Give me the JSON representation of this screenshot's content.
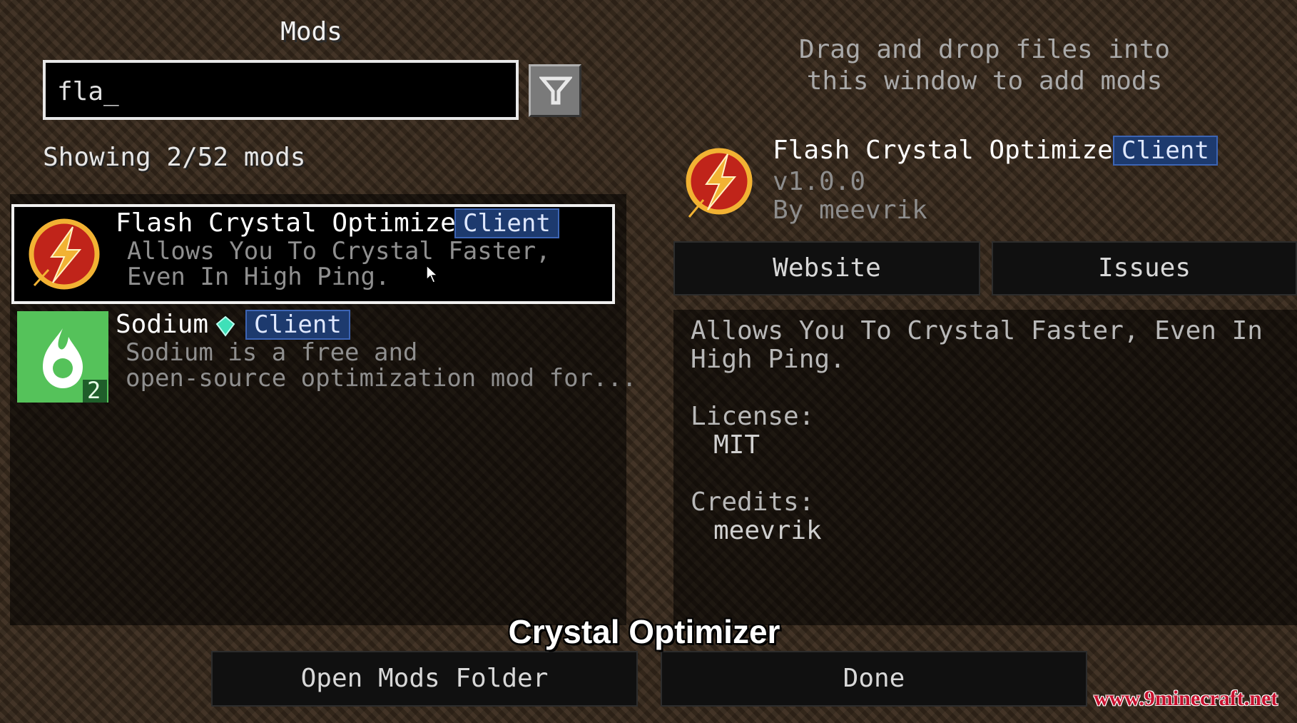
{
  "screen": {
    "title": "Mods",
    "search": {
      "value": "fla_"
    },
    "filter_button": {
      "icon": "filter-icon"
    },
    "showing_text": "Showing 2/52 mods",
    "drag_hint": [
      "Drag and drop files into",
      "this window to add mods"
    ]
  },
  "mods": [
    {
      "name": "Flash Crystal Optimizer",
      "badge": "Client",
      "description": [
        "Allows You To Crystal Faster,",
        "Even In High Ping."
      ],
      "icon": "flash-lightning-icon",
      "selected": true
    },
    {
      "name": "Sodium",
      "badge": "Client",
      "description": [
        "Sodium is a free and",
        "open-source optimization mod for..."
      ],
      "icon": "sodium-flame-icon",
      "icon_count": "2",
      "extra_icon": "diamond-icon",
      "selected": false
    }
  ],
  "detail": {
    "name": "Flash Crystal Optimizer",
    "badge": "Client",
    "version": "v1.0.0",
    "author": "By meevrik",
    "website_button": "Website",
    "issues_button": "Issues",
    "description": [
      "Allows You To Crystal Faster, Even In",
      "High Ping."
    ],
    "license_label": "License:",
    "license_value": "MIT",
    "credits_label": "Credits:",
    "credits_value": "meevrik"
  },
  "footer": {
    "open_folder_button": "Open Mods Folder",
    "done_button": "Done"
  },
  "overlay": {
    "caption": "Crystal Optimizer",
    "watermark": "www.9minecraft.net"
  },
  "colors": {
    "badge_bg": "#1d3a6e",
    "badge_border": "#3c64b4",
    "sodium_green": "#55c25a",
    "flash_red": "#c0241a",
    "flash_gold": "#f2b233"
  }
}
